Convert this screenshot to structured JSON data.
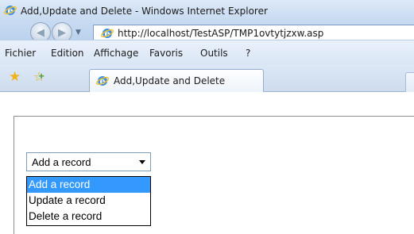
{
  "window": {
    "title": "Add,Update and Delete - Windows Internet Explorer",
    "icon": "ie-icon"
  },
  "navigation": {
    "address": "http://localhost/TestASP/TMP1ovtytjzxw.asp"
  },
  "menu": {
    "items": [
      "Fichier",
      "Edition",
      "Affichage",
      "Favoris",
      "Outils",
      "?"
    ]
  },
  "tabs": [
    {
      "label": "Add,Update and Delete"
    }
  ],
  "page": {
    "select": {
      "value": "Add a record",
      "options": [
        "Add a record",
        "Update a record",
        "Delete a record"
      ],
      "highlighted_index": 0
    }
  },
  "colors": {
    "highlight": "#3399ff",
    "chrome": "#cddcee"
  }
}
